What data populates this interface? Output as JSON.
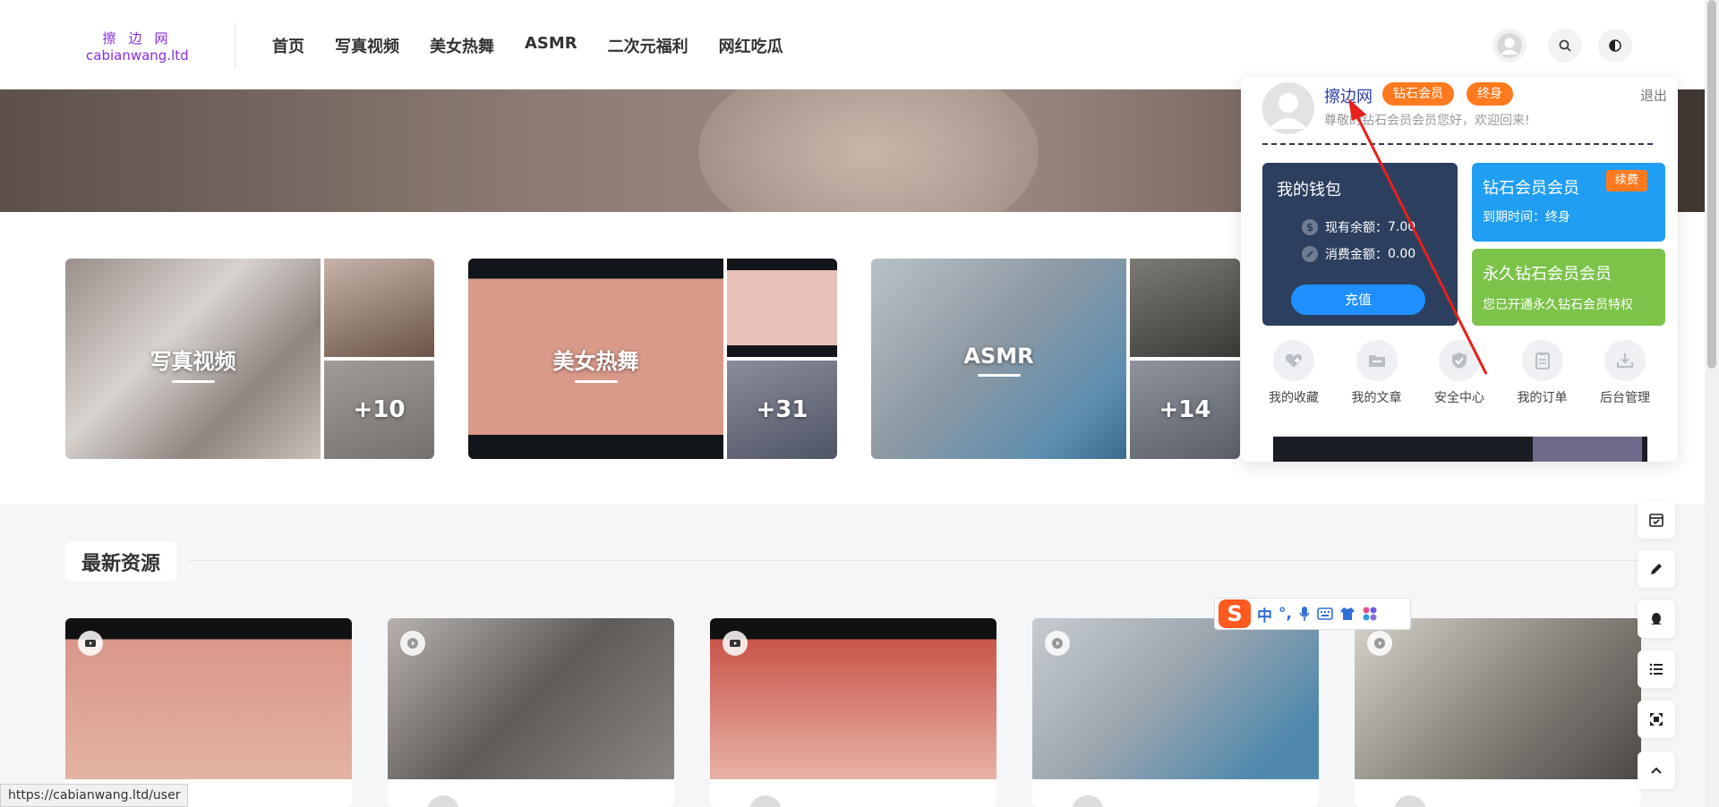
{
  "logo": {
    "cn": "擦边网",
    "en": "cabianwang.ltd"
  },
  "nav": [
    "首页",
    "写真视频",
    "美女热舞",
    "ASMR",
    "二次元福利",
    "网红吃瓜"
  ],
  "header_icons": [
    "user-icon",
    "search-icon",
    "theme-toggle-icon"
  ],
  "categories": [
    {
      "title": "写真视频",
      "count": "+10"
    },
    {
      "title": "美女热舞",
      "count": "+31"
    },
    {
      "title": "ASMR",
      "count": "+14"
    }
  ],
  "section_title": "最新资源",
  "status_url": "https://cabianwang.ltd/user",
  "ime": {
    "logo": "S",
    "mode": "中",
    "punct": "°,"
  },
  "user_panel": {
    "username": "擦边网",
    "badge_vip": "钻石会员",
    "badge_term": "终身",
    "logout": "退出",
    "greeting": "尊敬的钻石会员会员您好，欢迎回来!",
    "wallet": {
      "title": "我的钱包",
      "balance_label": "现有余额：",
      "balance_value": "7.00",
      "spent_label": "消费金额：",
      "spent_value": "0.00",
      "recharge": "充值",
      "balance_icon": "$"
    },
    "vip": {
      "title": "钻石会员会员",
      "renew": "续费",
      "expire": "到期时间：终身"
    },
    "permanent": {
      "title": "永久钻石会员会员",
      "desc": "您已开通永久钻石会员特权"
    },
    "menu": [
      "我的收藏",
      "我的文章",
      "安全中心",
      "我的订单",
      "后台管理"
    ]
  },
  "colors": {
    "brand_purple": "#8a2be2",
    "wallet_bg": "#2c3f5e",
    "vip_blue": "#1f9ef2",
    "perm_green": "#7cc34a",
    "badge_orange": "#ff7a1f",
    "arrow_red": "#e8211a"
  }
}
